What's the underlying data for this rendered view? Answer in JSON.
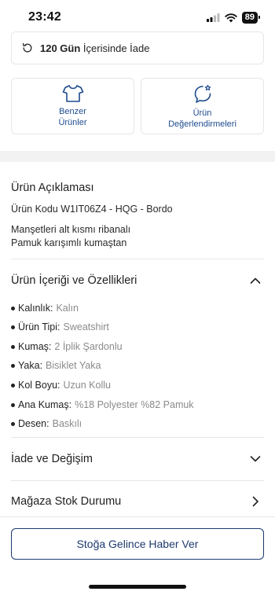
{
  "status_bar": {
    "time": "23:42",
    "battery": "89"
  },
  "return_policy": {
    "bold": "120 Gün",
    "rest": "İçerisinde İade"
  },
  "features": [
    {
      "label": "Benzer\nÜrünler",
      "icon": "tshirt-icon"
    },
    {
      "label": "Ürün\nDeğerlendirmeleri",
      "icon": "review-badge-icon"
    }
  ],
  "description": {
    "title": "Ürün Açıklaması",
    "code": "Ürün Kodu W1IT06Z4 - HQG - Bordo",
    "lines": [
      "Manşetleri alt kısmı ribanalı",
      "Pamuk karışımlı kumaştan"
    ]
  },
  "specs": {
    "title": "Ürün İçeriği ve Özellikleri",
    "items": [
      {
        "key": "Kalınlık:",
        "value": "Kalın"
      },
      {
        "key": "Ürün Tipi:",
        "value": "Sweatshirt"
      },
      {
        "key": "Kumaş:",
        "value": "2 İplik Şardonlu"
      },
      {
        "key": "Yaka:",
        "value": "Bisiklet Yaka"
      },
      {
        "key": "Kol Boyu:",
        "value": "Uzun Kollu"
      },
      {
        "key": "Ana Kumaş:",
        "value": "%18 Polyester %82 Pamuk"
      },
      {
        "key": "Desen:",
        "value": "Baskılı"
      }
    ]
  },
  "returns_section": {
    "title": "İade ve Değişim"
  },
  "stock_section": {
    "title": "Mağaza Stok Durumu"
  },
  "notify_button": {
    "label": "Stoğa Gelince Haber Ver"
  },
  "colors": {
    "accent": "#1e4b8f",
    "button_border": "#1e3a6e"
  }
}
